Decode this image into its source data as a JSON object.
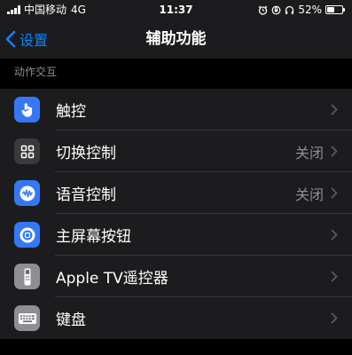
{
  "statusbar": {
    "carrier": "中国移动",
    "network": "4G",
    "time": "11:37",
    "battery_percent": "52%",
    "battery_level": 0.52
  },
  "navbar": {
    "back_label": "设置",
    "title": "辅助功能"
  },
  "main": {
    "section_header": "动作交互",
    "items": [
      {
        "label": "触控",
        "value": "",
        "icon": "hand-touch-icon",
        "icon_color": "#3478f6"
      },
      {
        "label": "切换控制",
        "value": "关闭",
        "icon": "grid-icon",
        "icon_color": "#3a3a3c"
      },
      {
        "label": "语音控制",
        "value": "关闭",
        "icon": "voice-control-icon",
        "icon_color": "#3478f6"
      },
      {
        "label": "主屏幕按钮",
        "value": "",
        "icon": "home-button-icon",
        "icon_color": "#3478f6"
      },
      {
        "label": "Apple TV遥控器",
        "value": "",
        "icon": "remote-icon",
        "icon_color": "#8e8e93"
      },
      {
        "label": "键盘",
        "value": "",
        "icon": "keyboard-icon",
        "icon_color": "#8e8e93"
      }
    ]
  },
  "colors": {
    "accent": "#0a84ff",
    "background": "#000000",
    "cell": "#1c1c1e",
    "secondary_text": "#8e8e93"
  }
}
